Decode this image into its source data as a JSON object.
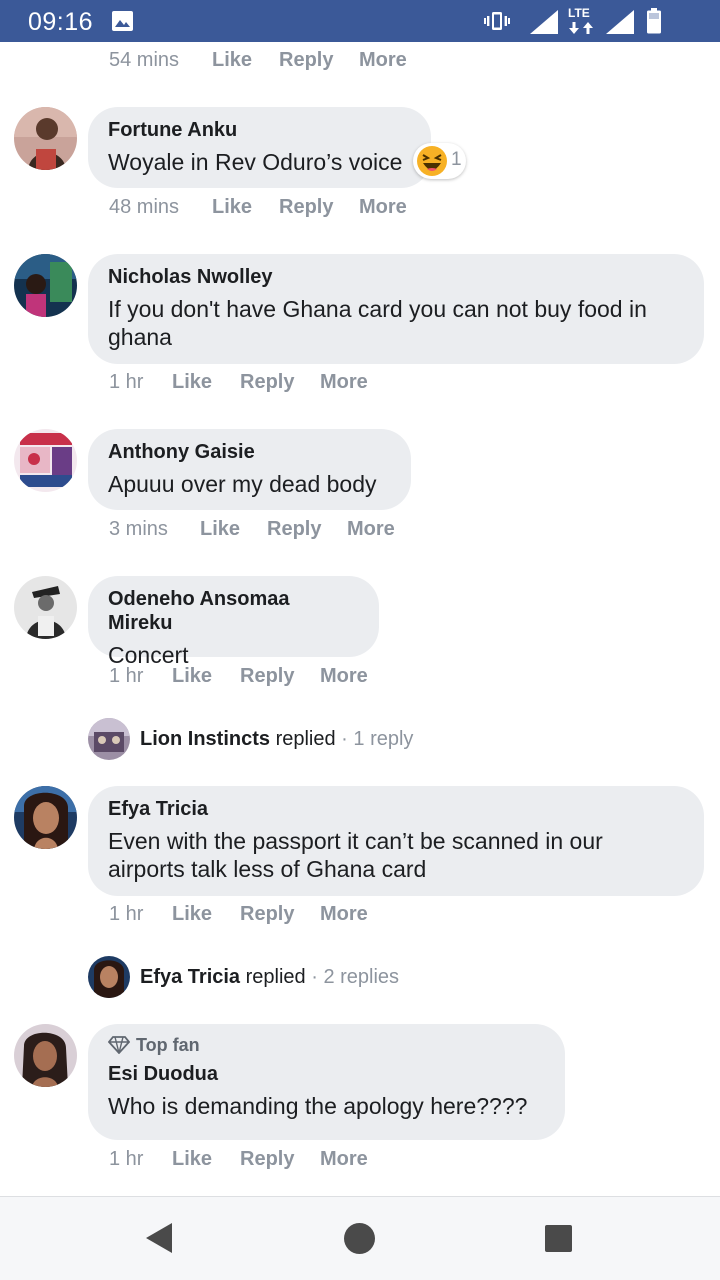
{
  "status_bar": {
    "time": "09:16",
    "network": "LTE"
  },
  "comments": [
    {
      "meta": {
        "time": "54 mins",
        "like": "Like",
        "reply": "Reply",
        "more": "More"
      }
    },
    {
      "author": "Fortune Anku",
      "text": "Woyale in Rev Oduro’s voice",
      "reaction": {
        "icon": "haha-emoji-icon",
        "count": "1"
      },
      "meta": {
        "time": "48 mins",
        "like": "Like",
        "reply": "Reply",
        "more": "More"
      }
    },
    {
      "author": "Nicholas Nwolley",
      "text_lines": [
        "If you don't have Ghana card you can not buy food in",
        "ghana"
      ],
      "meta": {
        "time": "1 hr",
        "like": "Like",
        "reply": "Reply",
        "more": "More"
      }
    },
    {
      "author": "Anthony Gaisie",
      "text": "Apuuu over my dead body",
      "meta": {
        "time": "3 mins",
        "like": "Like",
        "reply": "Reply",
        "more": "More"
      }
    },
    {
      "author": "Odeneho Ansomaa Mireku",
      "text": "Concert",
      "meta": {
        "time": "1 hr",
        "like": "Like",
        "reply": "Reply",
        "more": "More"
      },
      "replies": {
        "who": "Lion Instincts",
        "verb": "replied",
        "count": "· 1 reply"
      }
    },
    {
      "author": "Efya Tricia",
      "text_lines": [
        "Even with the passport it can’t be scanned in our",
        "airports talk less of Ghana card"
      ],
      "meta": {
        "time": "1 hr",
        "like": "Like",
        "reply": "Reply",
        "more": "More"
      },
      "replies": {
        "who": "Efya Tricia",
        "verb": "replied",
        "count": "· 2 replies"
      }
    },
    {
      "badge": "Top fan",
      "author": "Esi Duodua",
      "text": "Who is demanding the apology here????",
      "meta": {
        "time": "1 hr",
        "like": "Like",
        "reply": "Reply",
        "more": "More"
      }
    }
  ],
  "nav_bar": {
    "back_icon": "back-triangle-icon",
    "home_icon": "home-circle-icon",
    "recents_icon": "recents-square-icon"
  },
  "colors": {
    "status_bar": "#3b5998",
    "bubble": "#ebedf0",
    "meta_text": "#8d949e"
  }
}
